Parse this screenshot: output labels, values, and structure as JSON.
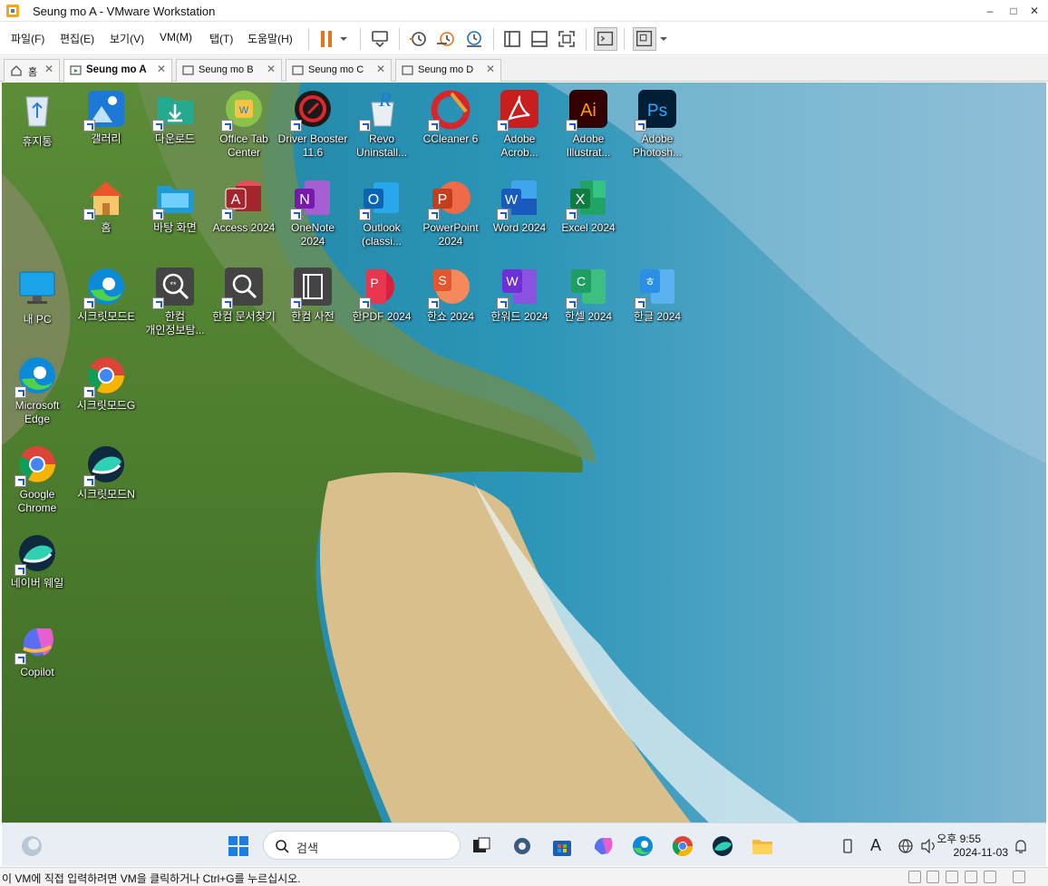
{
  "window": {
    "title": "Seung mo A - VMware Workstation",
    "minimize": "–",
    "maximize": "□",
    "close": "✕"
  },
  "menu": [
    "파일(F)",
    "편집(E)",
    "보기(V)",
    "VM(M)",
    "탭(T)",
    "도움말(H)"
  ],
  "toolbar_icons": [
    "pause-icon",
    "dropdown-icon",
    "send-keys-icon",
    "snapshot-icon",
    "revert-snapshot-icon",
    "snapshot-manager-icon",
    "library-icon",
    "console-only-icon",
    "full-screen-icon",
    "terminal-icon",
    "unity-icon"
  ],
  "tabs": {
    "home": "홈",
    "vm_a": "Seung mo A",
    "vm_b": "Seung mo B",
    "vm_c": "Seung mo C",
    "vm_d": "Seung mo D",
    "close": "✕"
  },
  "desktop_icons": {
    "recycle": "휴지통",
    "gallery": "갤러리",
    "downloads": "다운로드",
    "officetab": "Office Tab Center",
    "driverbooster": "Driver Booster 11.6",
    "revo": "Revo Uninstall...",
    "ccleaner": "CCleaner 6",
    "acrobat": "Adobe Acrob...",
    "illustrator": "Adobe Illustrat...",
    "photoshop": "Adobe Photosh...",
    "home": "홈",
    "desktopfolder": "바탕 화면",
    "access": "Access 2024",
    "onenote": "OneNote 2024",
    "outlook": "Outlook (classi...",
    "powerpoint": "PowerPoint 2024",
    "word": "Word 2024",
    "excel": "Excel 2024",
    "mypc": "내 PC",
    "secretE": "시크릿모드E",
    "hancomprivacy": "한컴 개인정보탐...",
    "hancomfind": "한컴 문서찾기",
    "hancomdict": "한컴 사전",
    "hanpdf": "한PDF 2024",
    "hanshow": "한쇼 2024",
    "hanword": "한워드 2024",
    "hancell": "한셀 2024",
    "hangul": "한글 2024",
    "edge": "Microsoft Edge",
    "secretG": "시크릿모드G",
    "chrome": "Google Chrome",
    "secretN": "시크릿모드N",
    "whale": "네이버 웨일",
    "copilot": "Copilot"
  },
  "taskbar": {
    "search_placeholder": "검색",
    "time": "오후 9:55",
    "date": "2024-11-03",
    "items": [
      "start-icon",
      "search-icon",
      "task-view-icon",
      "settings-icon",
      "store-icon",
      "copilot-icon",
      "edge-icon",
      "chrome-icon",
      "whale-icon",
      "file-explorer-icon"
    ]
  },
  "status": {
    "text": "이 VM에 직접 입력하려면 VM을 클릭하거나 Ctrl+G를 누르십시오."
  },
  "colors": {
    "accent_orange": "#e8731a",
    "taskbar": "#e9eef5",
    "label_text": "#ffffff"
  }
}
